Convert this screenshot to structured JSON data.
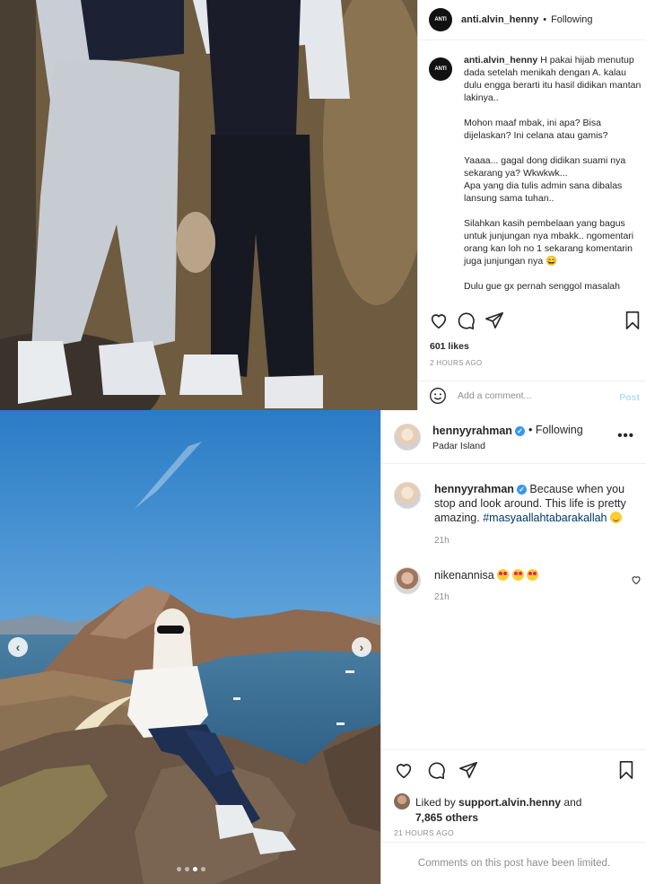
{
  "post1": {
    "username": "anti.alvin_henny",
    "avatar_text": "ANTI",
    "separator": "•",
    "follow_status": "Following",
    "more_label": "•••",
    "caption_paragraphs": [
      "H pakai hijab menutup dada setelah menikah dengan A. kalau dulu engga berarti itu hasil didikan mantan lakinya..",
      "Mohon maaf mbak, ini apa? Bisa dijelaskan? Ini celana atau gamis?",
      "Yaaaa... gagal dong didikan suami nya sekarang ya? Wkwkwk...\nApa yang dia tulis admin sana dibalas lansung sama tuhan..",
      "Silahkan kasih pembelaan yang bagus untuk junjungan nya mbakk.. ngomentari orang kan loh no 1 sekarang komentarin juga junjungan nya 😄",
      "Dulu gue gx pernah senggol masalah"
    ],
    "likes": "601 likes",
    "timestamp": "2 HOURS AGO",
    "comment_placeholder": "Add a comment...",
    "post_button": "Post",
    "icons": [
      "heart-icon",
      "comment-icon",
      "share-icon",
      "bookmark-icon",
      "emoji-icon"
    ]
  },
  "post2": {
    "username": "hennyyrahman",
    "verified_mark": "✓",
    "separator": "•",
    "follow_status": "Following",
    "location": "Padar Island",
    "more_label": "•••",
    "caption_text": "Because when you stop and look around. This life is pretty amazing.",
    "caption_hashtag": "#masyaallahtabarakallah",
    "caption_time": "21h",
    "comment": {
      "username": "nikenannisa",
      "time": "21h"
    },
    "liked_by_prefix": "Liked by",
    "liked_by_user": "support.alvin.henny",
    "liked_by_and": "and",
    "liked_by_others": "7,865 others",
    "timestamp": "21 HOURS AGO",
    "comments_limited": "Comments on this post have been limited.",
    "prev_arrow": "‹",
    "next_arrow": "›",
    "carousel_count": 4,
    "carousel_active": 3,
    "accent_color": "#3897f0",
    "hashtag_color": "#00376b"
  }
}
